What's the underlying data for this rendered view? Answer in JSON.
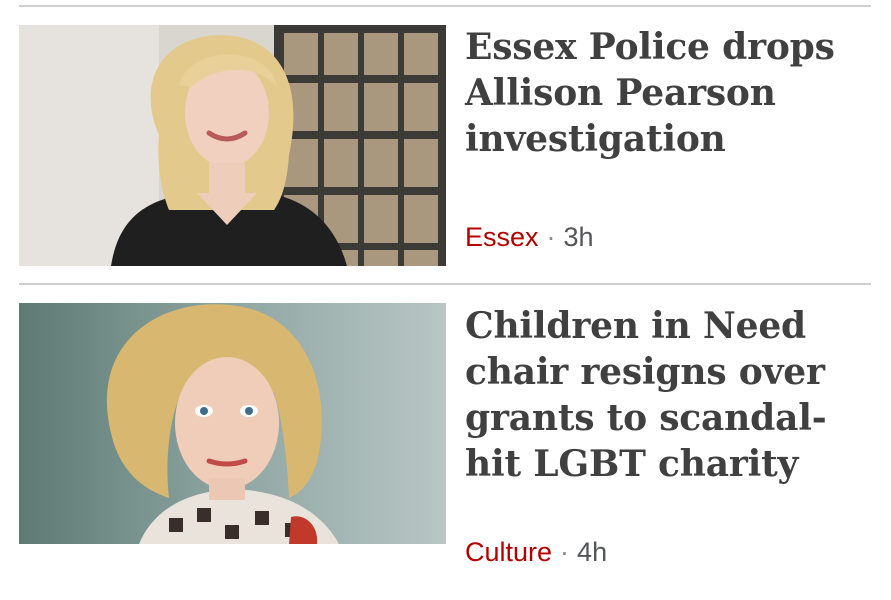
{
  "articles": [
    {
      "headline": "Essex Police drops Allison Pearson investigation",
      "section": "Essex",
      "separator": "·",
      "time": "3h"
    },
    {
      "headline": "Children in Need chair resigns over grants to scandal-hit LGBT charity",
      "section": "Culture",
      "separator": "·",
      "time": "4h"
    }
  ],
  "colors": {
    "section_link": "#b80000",
    "headline": "#404040",
    "timestamp": "#545658",
    "divider": "#cfcfcf"
  }
}
